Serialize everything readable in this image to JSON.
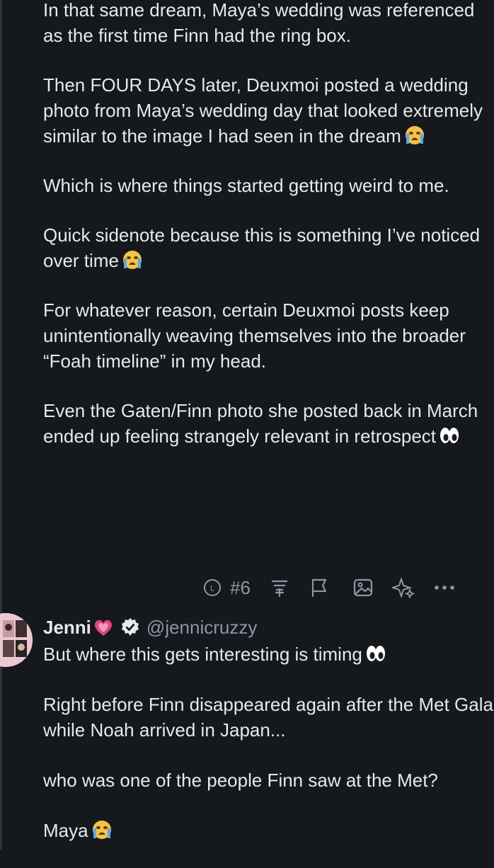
{
  "post": {
    "paragraphs": [
      {
        "text": "In that same dream, Maya’s wedding was referenced as the first time Finn had the ring box.",
        "emoji": ""
      },
      {
        "text": "Then FOUR DAYS later, Deuxmoi posted a wedding photo from Maya’s wedding day that looked extremely similar to the image I had seen in the dream",
        "emoji": "crying-emoji"
      },
      {
        "text": "Which is where things started getting weird to me.",
        "emoji": ""
      },
      {
        "text": "Quick sidenote because this is something I’ve noticed over time",
        "emoji": "crying-emoji"
      },
      {
        "text": "For whatever reason, certain Deuxmoi posts keep unintentionally weaving themselves into the broader “Foah timeline” in my head.",
        "emoji": ""
      },
      {
        "text": "Even the Gaten/Finn photo she posted back in March ended up feeling strangely relevant in retrospect",
        "emoji": "eyes-emoji"
      }
    ],
    "actions": {
      "count": "#6",
      "icons": [
        "views-icon",
        "thread-add-icon",
        "flag-icon",
        "image-icon",
        "sparkles-icon",
        "more-icon"
      ]
    }
  },
  "reply": {
    "name": "Jenni",
    "name_emoji": "pink-heart-emoji",
    "handle": "@jennicruzzy",
    "paragraphs": [
      {
        "text": "But where this gets interesting is timing",
        "emoji": "eyes-emoji"
      },
      {
        "text": "Right before Finn disappeared again after the Met Gala while Noah arrived in Japan...",
        "emoji": ""
      },
      {
        "text": "who was one of the people Finn saw at the Met?",
        "emoji": ""
      },
      {
        "text": "Maya",
        "emoji": "crying-emoji"
      }
    ]
  },
  "colors": {
    "background": "#15181c",
    "text": "#e7e9ea",
    "muted": "#8b98a5",
    "heart": "#e0457b"
  }
}
